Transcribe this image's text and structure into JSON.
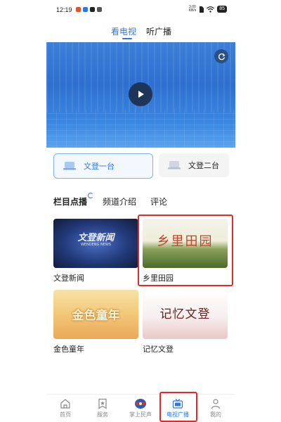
{
  "status_bar": {
    "time": "12:19",
    "net_speed_top": "3.00",
    "net_speed_bottom": "KB/s",
    "battery": "85"
  },
  "top_tabs": [
    {
      "label": "看电视",
      "active": true
    },
    {
      "label": "听广播",
      "active": false
    }
  ],
  "player": {
    "play_icon": "play-icon",
    "refresh_icon": "refresh-icon"
  },
  "channels": [
    {
      "label": "文登一台",
      "selected": true
    },
    {
      "label": "文登二台",
      "selected": false
    }
  ],
  "section_tabs": [
    {
      "label": "栏目点播",
      "active": true
    },
    {
      "label": "频道介绍",
      "active": false
    },
    {
      "label": "评论",
      "active": false
    }
  ],
  "programs": [
    {
      "title": "文登新闻",
      "thumb_title": "文登新闻",
      "thumb_sub": "WENDENG NEWS"
    },
    {
      "title": "乡里田园",
      "thumb_title": "乡里田园",
      "highlighted": true
    },
    {
      "title": "金色童年",
      "thumb_title": "金色童年"
    },
    {
      "title": "记忆文登",
      "thumb_title": "记忆文登"
    }
  ],
  "bottom_nav": [
    {
      "label": "首页",
      "icon": "home-icon"
    },
    {
      "label": "服务",
      "icon": "bookmark-icon"
    },
    {
      "label": "掌上民声",
      "icon": "voice-logo-icon"
    },
    {
      "label": "电视广播",
      "icon": "tv-icon",
      "active": true,
      "highlighted": true
    },
    {
      "label": "我的",
      "icon": "person-icon"
    }
  ],
  "colors": {
    "accent": "#2e78e6",
    "highlight_box": "#e32a2a"
  }
}
